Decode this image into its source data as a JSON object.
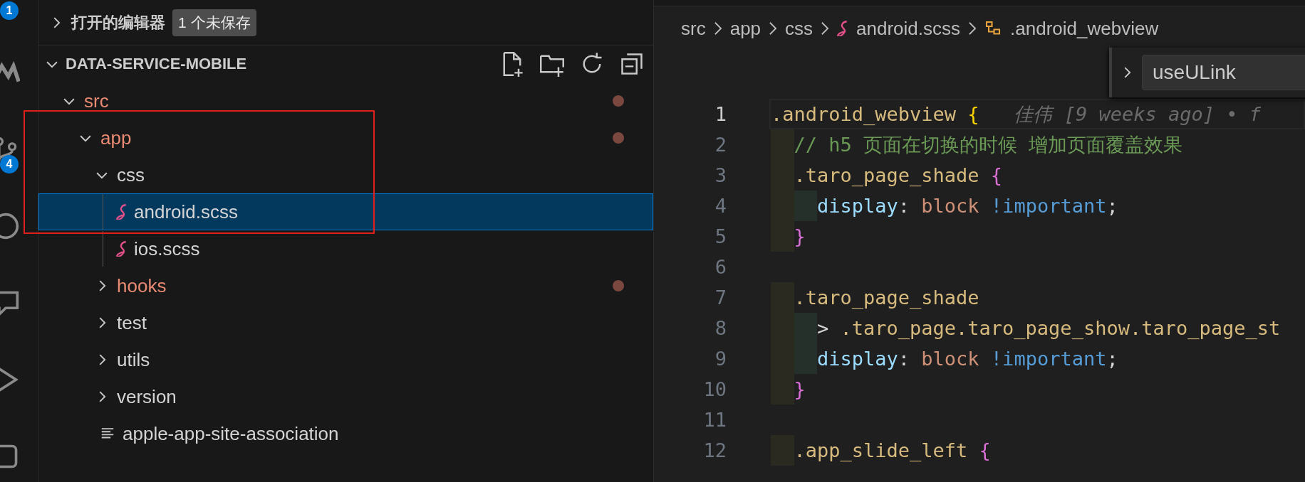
{
  "activity_bar": [
    {
      "kind": "explorer",
      "badge": "1"
    },
    {
      "kind": "remote"
    },
    {
      "kind": "source-control",
      "badge": "4"
    },
    {
      "kind": "circle"
    },
    {
      "kind": "chat"
    },
    {
      "kind": "run"
    },
    {
      "kind": "square"
    }
  ],
  "open_editors": {
    "title": "打开的编辑器",
    "expanded": false,
    "badge": "1 个未保存"
  },
  "project": {
    "title": "DATA-SERVICE-MOBILE",
    "expanded": true,
    "tree": [
      {
        "label": "src",
        "kind": "folder",
        "expanded": true,
        "modified": true,
        "selected": false,
        "children": [
          {
            "label": "app",
            "kind": "folder",
            "expanded": true,
            "modified": true,
            "selected": false,
            "children": [
              {
                "label": "css",
                "kind": "folder",
                "expanded": true,
                "modified": false,
                "selected": false,
                "children": [
                  {
                    "label": "android.scss",
                    "kind": "scss",
                    "modified": false,
                    "selected": true
                  },
                  {
                    "label": "ios.scss",
                    "kind": "scss",
                    "modified": false,
                    "selected": false
                  }
                ]
              },
              {
                "label": "hooks",
                "kind": "folder",
                "expanded": false,
                "modified": true,
                "selected": false
              },
              {
                "label": "test",
                "kind": "folder",
                "expanded": false,
                "modified": false,
                "selected": false
              },
              {
                "label": "utils",
                "kind": "folder",
                "expanded": false,
                "modified": false,
                "selected": false
              },
              {
                "label": "version",
                "kind": "folder",
                "expanded": false,
                "modified": false,
                "selected": false
              },
              {
                "label": "apple-app-site-association",
                "kind": "text",
                "modified": false,
                "selected": false
              }
            ]
          }
        ]
      }
    ]
  },
  "breadcrumb": [
    {
      "label": "src",
      "kind": "folder"
    },
    {
      "label": "app",
      "kind": "folder"
    },
    {
      "label": "css",
      "kind": "folder"
    },
    {
      "label": "android.scss",
      "kind": "scss"
    },
    {
      "label": ".android_webview",
      "kind": "symbol"
    }
  ],
  "find_widget": {
    "expanded": false,
    "value": "useULink"
  },
  "code": [
    {
      "number": "1",
      "selected": true,
      "tokens": [
        {
          "kind": "selector",
          "text": ".android_webview"
        },
        {
          "kind": "brace1",
          "text": " {"
        },
        {
          "kind": "blame",
          "text": "佳伟 [9 weeks ago] • f"
        }
      ]
    },
    {
      "number": "2",
      "selected": false,
      "tokens": [
        {
          "kind": "comment",
          "text": "  // h5 页面在切换的时候 增加页面覆盖效果"
        }
      ]
    },
    {
      "number": "3",
      "selected": false,
      "tokens": [
        {
          "kind": "selector",
          "text": "  .taro_page_shade"
        },
        {
          "kind": "brace2",
          "text": " {"
        }
      ]
    },
    {
      "number": "4",
      "selected": false,
      "tokens": [
        {
          "kind": "property",
          "text": "    display"
        },
        {
          "kind": "plain",
          "text": ":"
        },
        {
          "kind": "value",
          "text": " block"
        },
        {
          "kind": "important",
          "text": " !important"
        },
        {
          "kind": "plain",
          "text": ";"
        }
      ]
    },
    {
      "number": "5",
      "selected": false,
      "tokens": [
        {
          "kind": "brace2",
          "text": "  }"
        }
      ]
    },
    {
      "number": "6",
      "selected": false
    },
    {
      "number": "7",
      "selected": false,
      "tokens": [
        {
          "kind": "selector",
          "text": "  .taro_page_shade"
        }
      ]
    },
    {
      "number": "8",
      "selected": false,
      "tokens": [
        {
          "kind": "plain",
          "text": "    >"
        },
        {
          "kind": "selector",
          "text": " .taro_page.taro_page_show.taro_page_st"
        }
      ]
    },
    {
      "number": "9",
      "selected": false,
      "tokens": [
        {
          "kind": "property",
          "text": "    display"
        },
        {
          "kind": "plain",
          "text": ":"
        },
        {
          "kind": "value",
          "text": " block"
        },
        {
          "kind": "important",
          "text": " !important"
        },
        {
          "kind": "plain",
          "text": ";"
        }
      ]
    },
    {
      "number": "10",
      "selected": false,
      "tokens": [
        {
          "kind": "brace2",
          "text": "  }"
        }
      ]
    },
    {
      "number": "11",
      "selected": false
    },
    {
      "number": "12",
      "selected": false,
      "tokens": [
        {
          "kind": "selector",
          "text": "  .app_slide_left"
        },
        {
          "kind": "brace2",
          "text": " {"
        }
      ]
    }
  ]
}
